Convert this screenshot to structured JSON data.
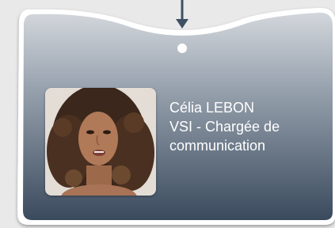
{
  "card": {
    "name": "Célia LEBON",
    "role_line1": "VSI - Chargée de",
    "role_line2": "communication"
  },
  "colors": {
    "background": "#e9e9e9",
    "card_top": "#c9ced5",
    "card_bottom": "#3f5063",
    "card_border": "#ffffff",
    "connector": "#3f5063",
    "text": "#ffffff"
  },
  "icons": {
    "connector": "arrow-down-icon",
    "anchor_dot": "dot-icon"
  }
}
